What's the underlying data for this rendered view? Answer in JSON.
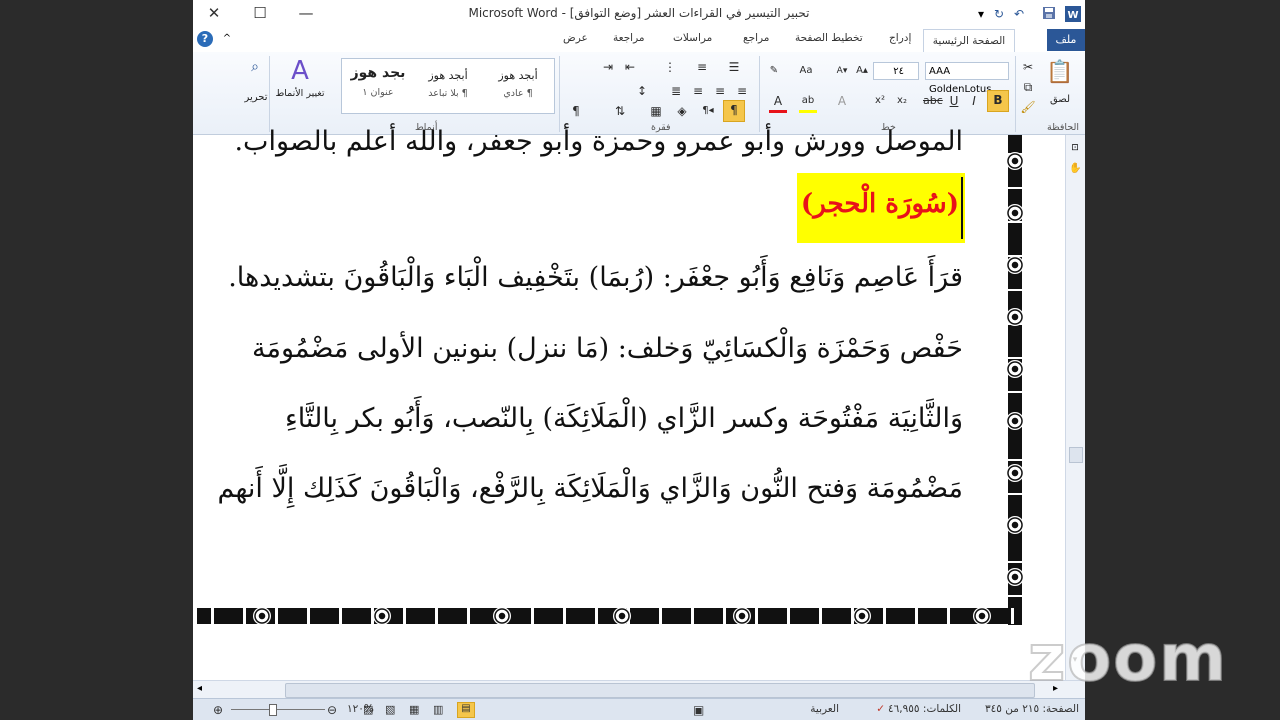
{
  "window": {
    "title": "تحبير التيسير في القراءات العشر [وضع التوافق] - Microsoft Word",
    "controls": {
      "close": "✕",
      "maximize": "☐",
      "minimize": "—"
    }
  },
  "tabs": {
    "file": "ملف",
    "home": "الصفحة الرئيسية",
    "insert": "إدراج",
    "page_layout": "تخطيط الصفحة",
    "references": "مراجع",
    "mailings": "مراسلات",
    "review": "مراجعة",
    "view": "عرض"
  },
  "ribbon": {
    "clipboard": {
      "label": "الحافظة",
      "paste": "لصق"
    },
    "font": {
      "label": "خط",
      "font_name": "AAA GoldenLotus",
      "font_size": "٢٤",
      "bold": "B",
      "underline": "U",
      "italic": "I"
    },
    "paragraph": {
      "label": "فقرة"
    },
    "styles": {
      "label": "أنماط",
      "items": [
        {
          "preview": "أبجد هوز",
          "name": "¶ عادي"
        },
        {
          "preview": "أبجد هوز",
          "name": "¶ بلا تباعد"
        },
        {
          "preview": "بجد هوز",
          "name": "عنوان ١"
        }
      ],
      "change_styles": "تغيير الأنماط"
    },
    "editing": {
      "label": "تحرير"
    }
  },
  "document": {
    "top_partial_line": "الموصل وورش وأبو عمرو وحمزة وأبو جعفر، والله أعلم بالصواب.",
    "surah_heading": "(سُورَة الْحجر)",
    "lines": [
      "قرَأَ عَاصِم وَنَافِع وَأَبُو جعْفَر: (رُبمَا) بتَخْفِيف الْبَاء وَالْبَاقُونَ بتشديدها.",
      "حَفْص وَحَمْزَة وَالْكسَائِيّ وَخلف: (مَا ننزل) بنونين الأولى مَضْمُومَة",
      "وَالثَّانِيَة مَفْتُوحَة وكسر الزَّاي (الْمَلَائِكَة) بِالنّصب، وَأَبُو بكر بِالتَّاءِ",
      "مَضْمُومَة وَفتح النُّون وَالزَّاي وَالْمَلَائِكَة بِالرَّفْع، وَالْبَاقُونَ كَذَلِك إِلَّا أَنهم"
    ]
  },
  "status": {
    "page": "الصفحة: ٢١٥ من ٣٤٥",
    "words": "الكلمات: ٤٦,٩٥٥",
    "language": "العربية",
    "zoom": "%١٢٠"
  },
  "watermark": "zoom",
  "colors": {
    "file_tab": "#2b5797",
    "highlight": "#ffff00",
    "heading_text": "#e8121a"
  }
}
